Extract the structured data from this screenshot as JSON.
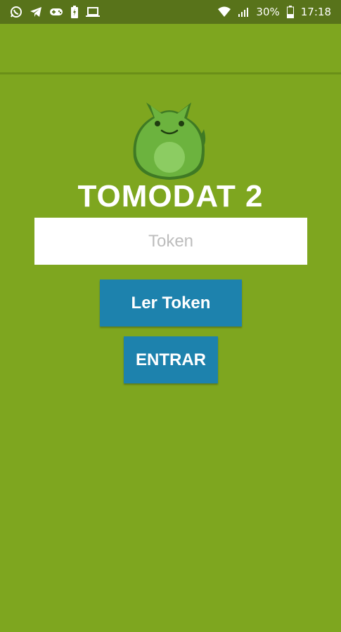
{
  "status_bar": {
    "battery_percent": "30%",
    "time": "17:18",
    "icons_left": [
      "whatsapp-icon",
      "telegram-icon",
      "gamepad-icon",
      "battery-charging-icon",
      "laptop-icon"
    ],
    "icons_right": [
      "wifi-icon",
      "signal-icon",
      "battery-icon"
    ]
  },
  "app": {
    "logo_text": "TOMODAT 2",
    "token_placeholder": "Token",
    "token_value": "",
    "read_token_label": "Ler Token",
    "enter_label": "ENTRAR"
  },
  "colors": {
    "background": "#7ea61f",
    "status_bar": "#58731a",
    "button": "#1d82ad",
    "input_bg": "#ffffff"
  }
}
